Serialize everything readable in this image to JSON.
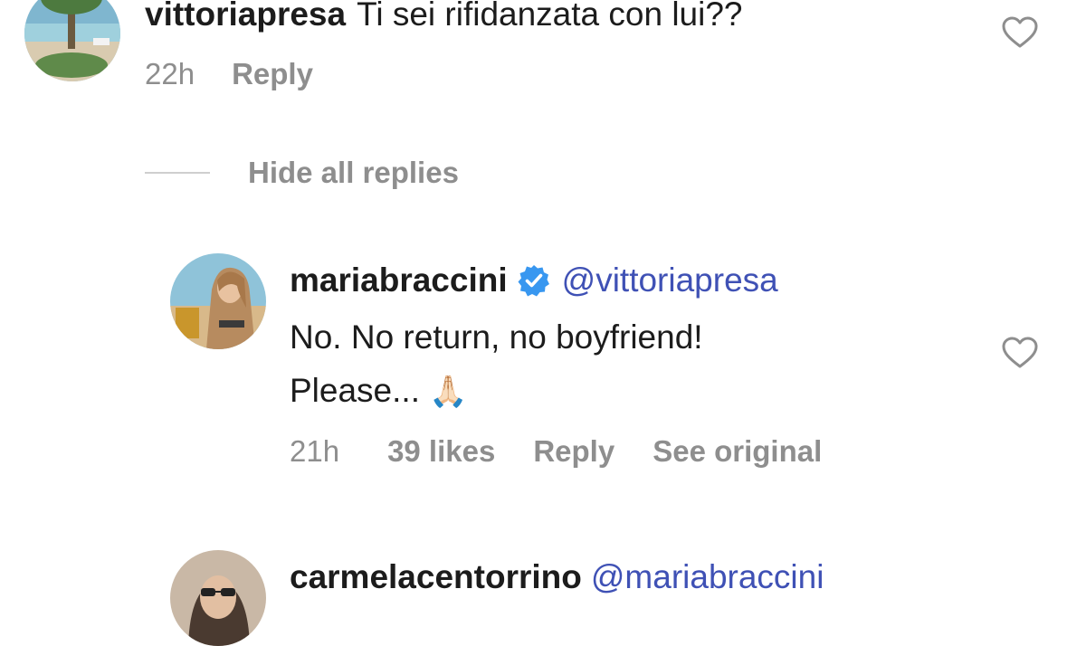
{
  "comments": [
    {
      "username": "vittoriapresa",
      "text": "Ti sei rifidanzata con lui??",
      "time": "22h",
      "reply_label": "Reply",
      "avatar_icon": "profile-photo-tree-beach"
    }
  ],
  "hide_replies_label": "Hide all replies",
  "replies": [
    {
      "username": "mariabraccini",
      "verified": true,
      "mention": "@vittoriapresa",
      "text_line1": "No. No return, no boyfriend!",
      "text_line2": "Please...",
      "emoji": "🙏🏻",
      "time": "21h",
      "likes": "39 likes",
      "reply_label": "Reply",
      "see_original_label": "See original",
      "avatar_icon": "profile-photo-woman-beach"
    },
    {
      "username": "carmelacentorrino",
      "mention": "@mariabraccini",
      "avatar_icon": "profile-photo-woman-sunglasses"
    }
  ],
  "icons": {
    "like": "heart-outline-icon",
    "verified": "verified-badge-icon"
  },
  "colors": {
    "mention": "#3f51b5",
    "verified": "#3897f0",
    "meta_text": "#8e8e8e",
    "primary_text": "#1c1c1c"
  }
}
